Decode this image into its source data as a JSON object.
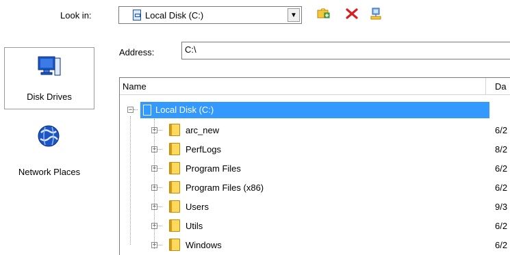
{
  "toolbar": {
    "look_in_label": "Look in:",
    "look_in_value": "Local Disk (C:)",
    "icons": [
      "new-folder-icon",
      "delete-icon",
      "map-network-drive-icon"
    ]
  },
  "nav": {
    "items": [
      {
        "label": "Disk Drives",
        "icon": "disk-drives-icon"
      },
      {
        "label": "Network Places",
        "icon": "network-places-icon"
      }
    ]
  },
  "address": {
    "label": "Address:",
    "value": "C:\\"
  },
  "tree": {
    "headers": {
      "name": "Name",
      "date": "Da"
    },
    "root": {
      "label": "Local Disk (C:)"
    },
    "items": [
      {
        "label": "arc_new",
        "date": "6/2"
      },
      {
        "label": "PerfLogs",
        "date": "8/2"
      },
      {
        "label": "Program Files",
        "date": "6/2"
      },
      {
        "label": "Program Files (x86)",
        "date": "6/2"
      },
      {
        "label": "Users",
        "date": "9/3"
      },
      {
        "label": "Utils",
        "date": "6/2"
      },
      {
        "label": "Windows",
        "date": "6/2"
      }
    ]
  },
  "colors": {
    "selection": "#3399ff",
    "folder": "#ffd95c",
    "border": "#7a7a7a"
  }
}
